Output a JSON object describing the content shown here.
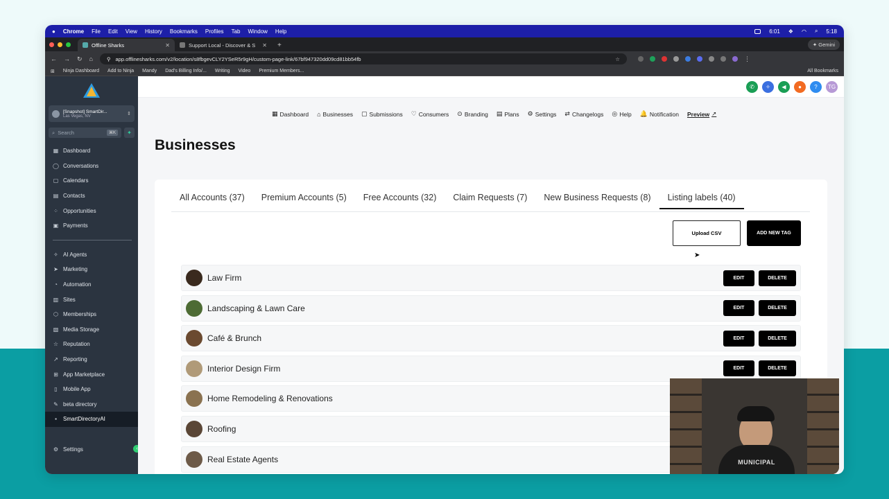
{
  "menubar": {
    "app": "Chrome",
    "items": [
      "File",
      "Edit",
      "View",
      "History",
      "Bookmarks",
      "Profiles",
      "Tab",
      "Window",
      "Help"
    ],
    "battery_time": "6:01",
    "clock": "5:18"
  },
  "browser": {
    "tabs": [
      {
        "title": "Offline Sharks"
      },
      {
        "title": "Support Local - Discover & S"
      }
    ],
    "gemini_label": "Gemini",
    "url": "app.offlinesharks.com/v2/location/s8fbgevCLY2YSeR5r9gH/custom-page-link/67bf947320dd09cd81bb54fb",
    "bookmarks": [
      "Ninja Dashboard",
      "Add to Ninja",
      "Mandy",
      "Dad's Billing Info/...",
      "Writing",
      "Video",
      "Premium Members..."
    ],
    "all_bookmarks": "All Bookmarks"
  },
  "sidebar": {
    "account_name": "[Snapshot] SmartDir...",
    "account_location": "Las Vegas, NV",
    "search_placeholder": "Search",
    "search_kbd": "⌘K",
    "nav_top": [
      {
        "label": "Dashboard",
        "icon": "grid-icon",
        "glyph": "▦"
      },
      {
        "label": "Conversations",
        "icon": "chat-icon",
        "glyph": "◯"
      },
      {
        "label": "Calendars",
        "icon": "calendar-icon",
        "glyph": "▢"
      },
      {
        "label": "Contacts",
        "icon": "contacts-icon",
        "glyph": "▤"
      },
      {
        "label": "Opportunities",
        "icon": "opportunities-icon",
        "glyph": "⁘"
      },
      {
        "label": "Payments",
        "icon": "payments-icon",
        "glyph": "▣"
      }
    ],
    "nav_bottom": [
      {
        "label": "AI Agents",
        "icon": "sparkle-icon",
        "glyph": "✧"
      },
      {
        "label": "Marketing",
        "icon": "send-icon",
        "glyph": "➤"
      },
      {
        "label": "Automation",
        "icon": "automation-icon",
        "glyph": "◔"
      },
      {
        "label": "Sites",
        "icon": "sites-icon",
        "glyph": "▥"
      },
      {
        "label": "Memberships",
        "icon": "memberships-icon",
        "glyph": "⬡"
      },
      {
        "label": "Media Storage",
        "icon": "media-icon",
        "glyph": "▧"
      },
      {
        "label": "Reputation",
        "icon": "star-icon",
        "glyph": "☆"
      },
      {
        "label": "Reporting",
        "icon": "chart-icon",
        "glyph": "↗"
      },
      {
        "label": "App Marketplace",
        "icon": "marketplace-icon",
        "glyph": "⊞"
      },
      {
        "label": "Mobile App",
        "icon": "mobile-icon",
        "glyph": "▯"
      },
      {
        "label": "beta directory",
        "icon": "wrench-icon",
        "glyph": "✎"
      },
      {
        "label": "SmartDirectoryAI",
        "icon": "directory-icon",
        "glyph": "▪"
      }
    ],
    "settings_label": "Settings"
  },
  "header": {
    "avatar_initials": "TG",
    "nav": [
      {
        "label": "Dashboard",
        "icon": "dashboard-icon",
        "glyph": "▦"
      },
      {
        "label": "Businesses",
        "icon": "businesses-icon",
        "glyph": "⌂"
      },
      {
        "label": "Submissions",
        "icon": "submissions-icon",
        "glyph": "▢"
      },
      {
        "label": "Consumers",
        "icon": "heart-icon",
        "glyph": "♡"
      },
      {
        "label": "Branding",
        "icon": "branding-icon",
        "glyph": "⊙"
      },
      {
        "label": "Plans",
        "icon": "plans-icon",
        "glyph": "▤"
      },
      {
        "label": "Settings",
        "icon": "gear-icon",
        "glyph": "⚙"
      },
      {
        "label": "Changelogs",
        "icon": "swap-icon",
        "glyph": "⇄"
      },
      {
        "label": "Help",
        "icon": "help-icon",
        "glyph": "◎"
      },
      {
        "label": "Notification",
        "icon": "bell-icon",
        "glyph": "🔔"
      }
    ],
    "preview_label": "Preview"
  },
  "page": {
    "title": "Businesses",
    "tabs": [
      {
        "label": "All Accounts (37)",
        "active": false
      },
      {
        "label": "Premium Accounts (5)",
        "active": false
      },
      {
        "label": "Free Accounts (32)",
        "active": false
      },
      {
        "label": "Claim Requests (7)",
        "active": false
      },
      {
        "label": "New Business Requests (8)",
        "active": false
      },
      {
        "label": "Listing labels (40)",
        "active": true
      }
    ],
    "upload_label": "Upload CSV",
    "add_tag_label": "ADD NEW TAG",
    "edit_label": "EDIT",
    "delete_label": "DELETE",
    "labels": [
      {
        "name": "Law Firm",
        "color": "#3a2a1e"
      },
      {
        "name": "Landscaping & Lawn Care",
        "color": "#4d6b34"
      },
      {
        "name": "Café & Brunch",
        "color": "#6b4a30"
      },
      {
        "name": "Interior Design Firm",
        "color": "#b09a78"
      },
      {
        "name": "Home Remodeling & Renovations",
        "color": "#8a7250"
      },
      {
        "name": "Roofing",
        "color": "#5a4636"
      },
      {
        "name": "Real Estate Agents",
        "color": "#6d5a48"
      }
    ]
  },
  "webcam": {
    "shirt_text": "MUNICIPAL"
  }
}
